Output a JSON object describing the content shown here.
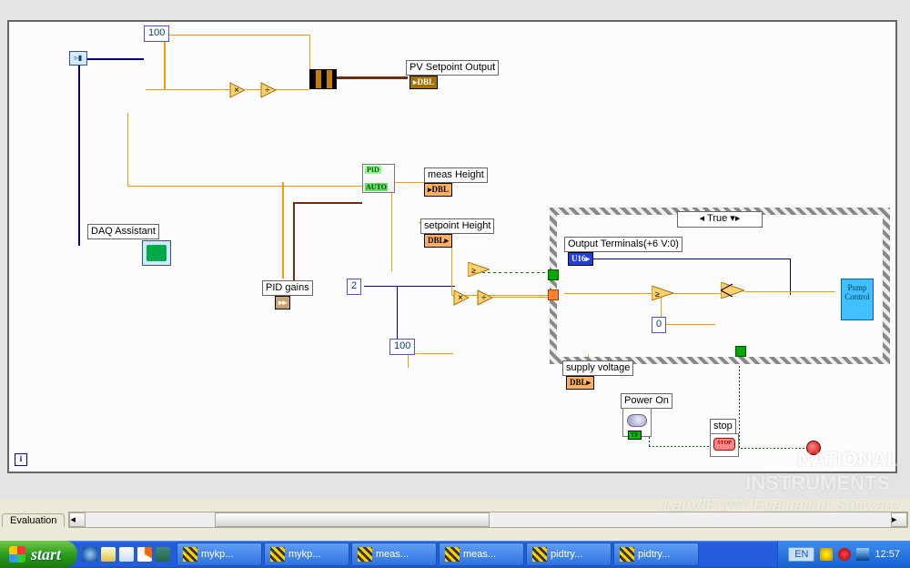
{
  "constants": {
    "hundred1": "100",
    "hundred2": "100",
    "two": "2",
    "zero": "0"
  },
  "labels": {
    "pvSetpoint": "PV Setpoint Output",
    "daq": "DAQ Assistant",
    "measHeight": "meas Height",
    "setpointHeight": "setpoint Height",
    "pidGains": "PID gains",
    "outputTerminals": "Output Terminals(+6 V:0)",
    "supplyVoltage": "supply voltage",
    "powerOn": "Power On",
    "stop": "stop"
  },
  "tags": {
    "dbl": "DBL",
    "u16": "U16",
    "tf": "TF",
    "arr": "DBL"
  },
  "case": {
    "value": "True"
  },
  "pump": {
    "line1": "Pump",
    "line2": "Control"
  },
  "iterm": "i",
  "evalTab": "Evaluation",
  "watermark": {
    "brand": "NATIONAL\nINSTRUMENTS",
    "sub": "LabVIEW™ Evaluation Software"
  },
  "taskbar": {
    "start": "start",
    "items": [
      "mykp...",
      "mykp...",
      "meas...",
      "meas...",
      "pidtry...",
      "pidtry..."
    ],
    "lang": "EN",
    "clock": "12:57"
  }
}
